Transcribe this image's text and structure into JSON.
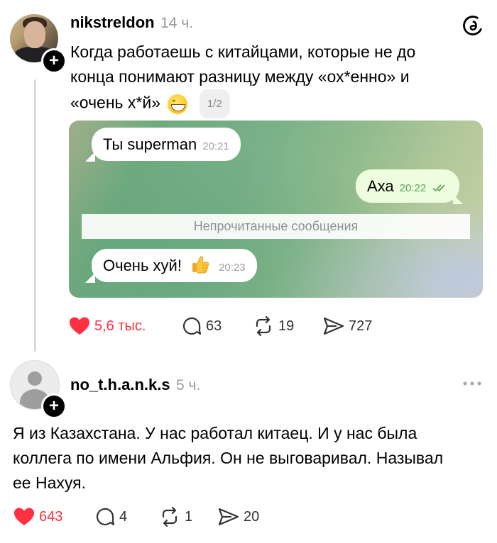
{
  "post1": {
    "username": "nikstreldon",
    "time": "14 ч.",
    "text_line1": "Когда работаешь с китайцами, которые не до",
    "text_line2": "конца понимают разницу между «ох*енно» и",
    "text_line3": "«очень х*й»",
    "page_indicator": "1/2",
    "chat": {
      "msg1_text": "Ты superman",
      "msg1_time": "20:21",
      "msg2_text": "Аха",
      "msg2_time": "20:22",
      "unread_label": "Непрочитанные сообщения",
      "msg3_text": "Очень хуй!",
      "msg3_time": "20:23"
    },
    "stats": {
      "likes": "5,6 тыс.",
      "comments": "63",
      "reposts": "19",
      "shares": "727"
    }
  },
  "post2": {
    "username": "no_t.h.a.n.k.s",
    "time": "5 ч.",
    "text_line1": "Я из Казахстана. У нас работал китаец. И у нас была",
    "text_line2": "коллега по имени Альфия. Он не выговаривал. Называл",
    "text_line3": "ее Нахуя.",
    "stats": {
      "likes": "643",
      "comments": "4",
      "reposts": "1",
      "shares": "20"
    }
  },
  "icons": {
    "app_logo": "threads-logo-icon",
    "like": "heart-icon",
    "comment": "comment-bubble-icon",
    "repost": "repost-icon",
    "share": "paper-plane-icon",
    "more": "more-dots-icon",
    "follow": "plus-icon"
  },
  "colors": {
    "like_active": "#ff3040",
    "muted_text": "#9a9a9a",
    "outgoing_bubble": "#eefdde",
    "read_check": "#5aa55e"
  }
}
